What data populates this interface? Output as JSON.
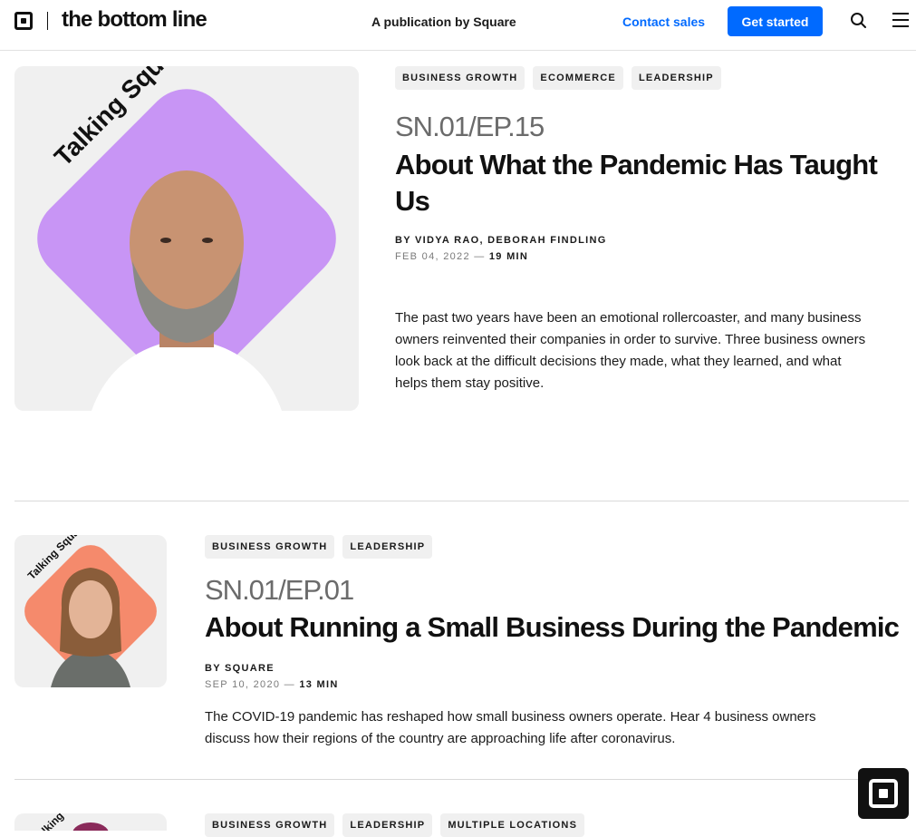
{
  "header": {
    "brand": "the bottom line",
    "publication": "A publication by Square",
    "contact_sales": "Contact sales",
    "get_started": "Get started",
    "search_icon": "search-icon",
    "menu_icon": "hamburger-menu-icon",
    "accent_color": "#006aff"
  },
  "articles": [
    {
      "tags": [
        "BUSINESS GROWTH",
        "ECOMMERCE",
        "LEADERSHIP"
      ],
      "thumbnail_text": "Talking Squarely",
      "thumbnail_color": "#c895f5",
      "episode": "SN.01/EP.15",
      "title_line1": "About What the Pandemic Has Taught",
      "title_line2": "Us",
      "byline": "BY VIDYA RAO, DEBORAH FINDLING",
      "date": "FEB 04, 2022 —",
      "duration": "19 MIN",
      "summary_lines": [
        "The past two years have been an emotional rollercoaster, and many business",
        "owners reinvented their companies in order to survive. Three business owners",
        "look back at the difficult decisions they made, what they learned, and what",
        "helps them stay positive."
      ]
    },
    {
      "tags": [
        "BUSINESS GROWTH",
        "LEADERSHIP"
      ],
      "thumbnail_text": "Talking Squarely",
      "thumbnail_color": "#f58a6c",
      "episode": "SN.01/EP.01",
      "title_line1": "About Running a Small Business During the Pandemic",
      "byline": "BY SQUARE",
      "date": "SEP 10, 2020 —",
      "duration": "13 MIN",
      "summary_lines": [
        "The COVID-19 pandemic has reshaped how small business owners operate. Hear 4 business owners",
        "discuss how their regions of the country are approaching life after coronavirus."
      ]
    },
    {
      "tags": [
        "BUSINESS GROWTH",
        "LEADERSHIP",
        "MULTIPLE LOCATIONS"
      ],
      "thumbnail_text": "Talking Squarely",
      "thumbnail_color": "#8a2a5a"
    }
  ],
  "floating_badge_icon": "square-logo-icon"
}
